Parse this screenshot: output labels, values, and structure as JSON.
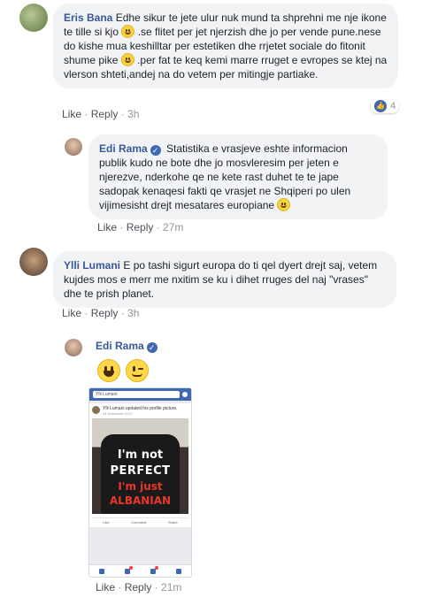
{
  "comments": [
    {
      "author": "Eris Bana",
      "text_parts": [
        "Edhe sikur te jete ulur nuk mund ta shprehni me nje ikone te tille si kjo",
        ".se flitet per jet njerzish dhe jo per vende pune.nese do kishe mua keshilltar per estetiken dhe rrjetet sociale do fitonit shume pike",
        ".per fat te keq kemi marre rruget e evropes se ktej na vlerson shteti,andej na do vetem per mitingje partiake."
      ],
      "actions": {
        "like": "Like",
        "reply": "Reply",
        "time": "3h"
      },
      "reaction_count": "4"
    },
    {
      "author": "Edi Rama",
      "text_parts": [
        "Statistika e vrasjeve eshte informacion publik kudo ne bote dhe jo mosvleresim per jeten e njerezve, nderkohe qe ne kete rast duhet te te jape sadopak kenaqesi fakti qe vrasjet ne Shqiperi po ulen vijimesisht drejt mesatares europiane"
      ],
      "actions": {
        "like": "Like",
        "reply": "Reply",
        "time": "27m"
      }
    },
    {
      "author": "Ylli Lumani",
      "text_parts": [
        "E po tashi sigurt europa do ti qel dyert drejt saj, vetem kujdes mos e merr me nxitim se ku i dihet rruges del naj \"vrases\" dhe te prish planet."
      ],
      "actions": {
        "like": "Like",
        "reply": "Reply",
        "time": "3h"
      }
    },
    {
      "author": "Edi Rama",
      "actions": {
        "like": "Like",
        "reply": "Reply",
        "time": "21m"
      }
    }
  ],
  "attachment": {
    "search_text": "Ylli Lumani",
    "post_header": "Ylli Lumani updated his profile picture.",
    "post_date": "14 December 2017 ·",
    "shirt_lines": [
      "I'm not",
      "PERFECT",
      "I'm just",
      "ALBANIAN"
    ],
    "stats_left": "",
    "stats_right": "",
    "actions": [
      "Like",
      "Comment",
      "Share"
    ]
  },
  "icons": [
    "smile-emoji",
    "wink-emoji",
    "verified-badge",
    "like-thumb"
  ],
  "colors": {
    "link": "#385898",
    "bubble": "#f2f3f5",
    "brand": "#4267b2"
  }
}
